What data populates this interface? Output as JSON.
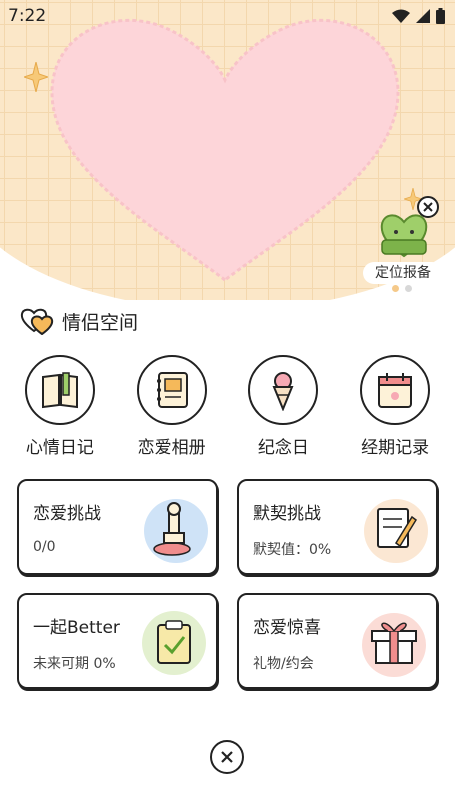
{
  "status": {
    "time": "7:22"
  },
  "banner": {
    "badge_label": "定位报备"
  },
  "section": {
    "title": "情侣空间"
  },
  "features": [
    {
      "label": "心情日记",
      "icon": "diary-book-icon"
    },
    {
      "label": "恋爱相册",
      "icon": "photo-album-icon"
    },
    {
      "label": "纪念日",
      "icon": "flower-bouquet-icon"
    },
    {
      "label": "经期记录",
      "icon": "calendar-icon"
    }
  ],
  "cards": [
    {
      "title": "恋爱挑战",
      "sub": "0/0",
      "icon": "stamp-icon",
      "accent": "#cfe3f7"
    },
    {
      "title": "默契挑战",
      "sub": "默契值：0%",
      "icon": "notepad-pencil-icon",
      "accent": "#fbe7d3"
    },
    {
      "title": "一起Better",
      "sub": "未来可期 0%",
      "icon": "checklist-icon",
      "accent": "#e3f0cf"
    },
    {
      "title": "恋爱惊喜",
      "sub": "礼物/约会",
      "icon": "gift-box-icon",
      "accent": "#fbdcd6"
    }
  ],
  "colors": {
    "heart": "#fdd5d9",
    "grid_bg": "#fbe7c8",
    "dot_active": "#f5c98a",
    "dot_inactive": "#d8d8d8"
  }
}
